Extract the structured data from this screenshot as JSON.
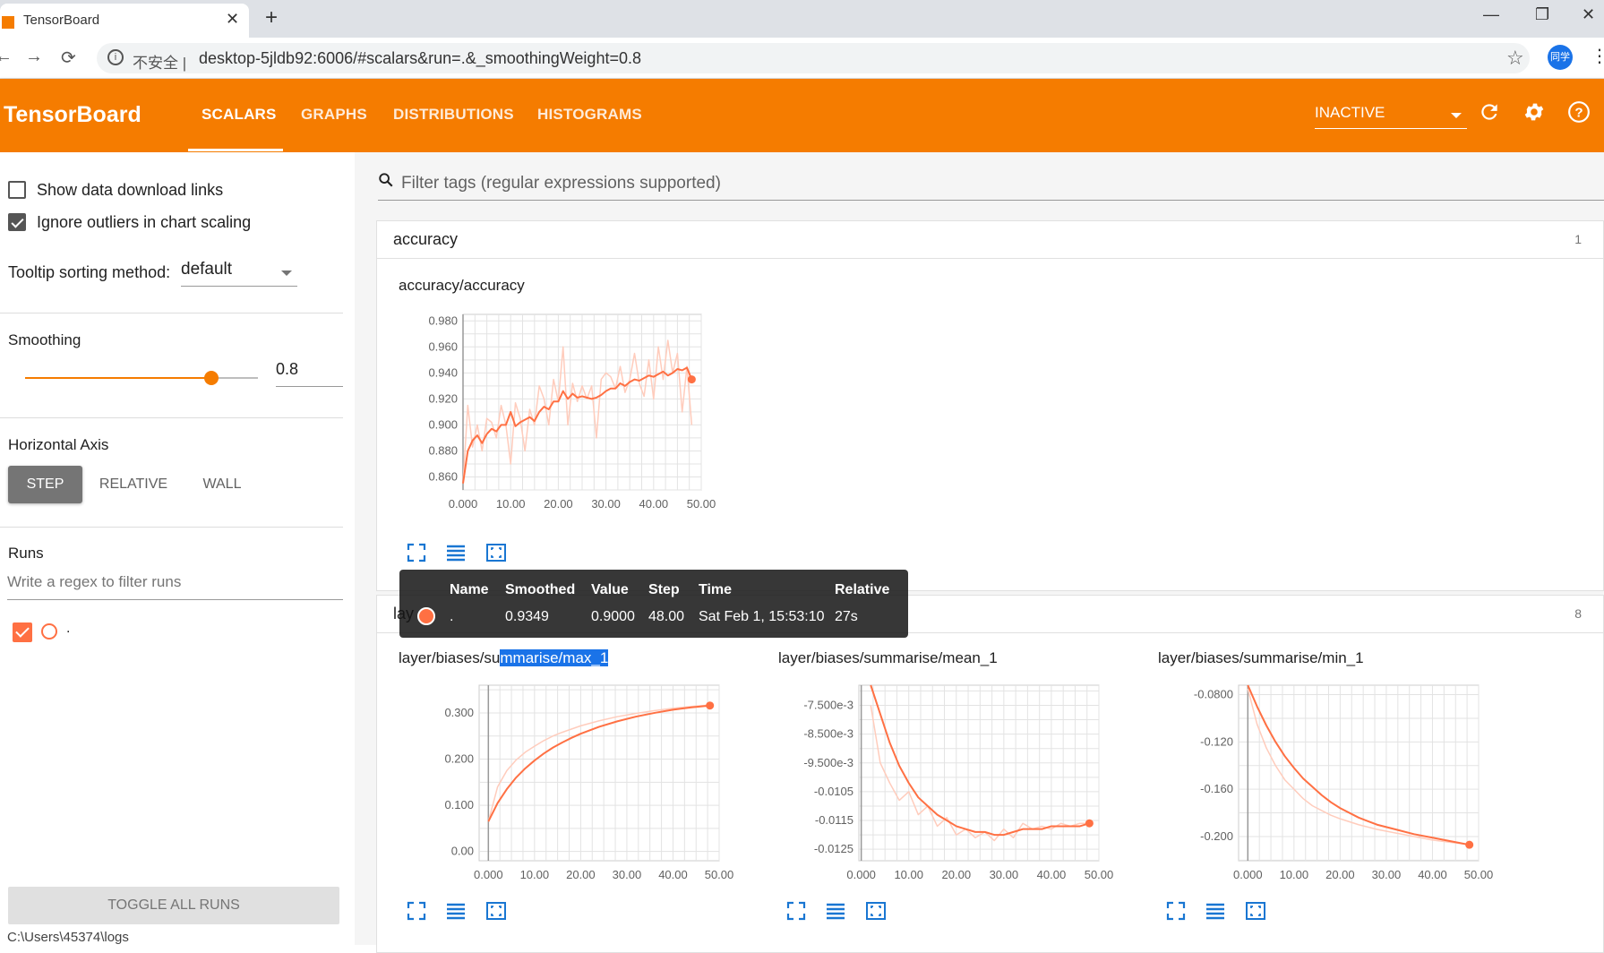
{
  "browser": {
    "tab_title": "TensorBoard",
    "tab_close": "✕",
    "new_tab": "+",
    "win_min": "—",
    "win_restore": "❐",
    "win_close": "✕",
    "back": "←",
    "forward": "→",
    "reload": "⟳",
    "insecure_label": "不安全 |",
    "url": "desktop-5jldb92:6006/#scalars&run=.&_smoothingWeight=0.8",
    "star": "☆",
    "profile": "同学",
    "menu": "⋮"
  },
  "header": {
    "brand": "TensorBoard",
    "tabs": [
      "SCALARS",
      "GRAPHS",
      "DISTRIBUTIONS",
      "HISTOGRAMS"
    ],
    "active_tab": "SCALARS",
    "status": "INACTIVE",
    "accent": "#f57c00"
  },
  "sidebar": {
    "show_download": "Show data download links",
    "show_download_checked": false,
    "ignore_outliers": "Ignore outliers in chart scaling",
    "ignore_outliers_checked": true,
    "tooltip_label": "Tooltip sorting method:",
    "tooltip_value": "default",
    "smoothing_label": "Smoothing",
    "smoothing_value": "0.8",
    "smoothing_fraction": 0.8,
    "haxis_label": "Horizontal Axis",
    "haxis_options": [
      "STEP",
      "RELATIVE",
      "WALL"
    ],
    "haxis_active": "STEP",
    "runs_label": "Runs",
    "runs_filter_placeholder": "Write a regex to filter runs",
    "run_name": ".",
    "run_color": "#ff7043",
    "toggle_all": "TOGGLE ALL RUNS",
    "logdir": "C:\\Users\\45374\\logs"
  },
  "main": {
    "filter_placeholder": "Filter tags (regular expressions supported)",
    "groups": [
      {
        "name": "accuracy",
        "count": "1"
      },
      {
        "name": "lay",
        "count": "8"
      }
    ],
    "charts": {
      "acc_title": "accuracy/accuracy",
      "max_title_pre": "layer/biases/su",
      "max_title_sel": "mmarise/max_1",
      "mean_title": "layer/biases/summarise/mean_1",
      "min_title": "layer/biases/summarise/min_1"
    }
  },
  "tooltip": {
    "headers": [
      "Name",
      "Smoothed",
      "Value",
      "Step",
      "Time",
      "Relative"
    ],
    "row": [
      ".",
      "0.9349",
      "0.9000",
      "48.00",
      "Sat Feb 1, 15:53:10",
      "27s"
    ]
  },
  "chart_data": [
    {
      "type": "line",
      "title": "accuracy/accuracy",
      "xlim": [
        0,
        50
      ],
      "ylim": [
        0.85,
        0.985
      ],
      "xticks": [
        "0.000",
        "10.00",
        "20.00",
        "30.00",
        "40.00",
        "50.00"
      ],
      "yticks": [
        "0.980",
        "0.960",
        "0.940",
        "0.920",
        "0.900",
        "0.880",
        "0.860"
      ],
      "ytick_values": [
        0.98,
        0.96,
        0.94,
        0.92,
        0.9,
        0.88,
        0.86
      ],
      "series": [
        {
          "name": "smoothed",
          "x": [
            0,
            1,
            2,
            3,
            4,
            5,
            6,
            7,
            8,
            9,
            10,
            11,
            12,
            13,
            14,
            15,
            16,
            17,
            18,
            19,
            20,
            21,
            22,
            23,
            24,
            25,
            26,
            27,
            28,
            29,
            30,
            31,
            32,
            33,
            34,
            35,
            36,
            37,
            38,
            39,
            40,
            41,
            42,
            43,
            44,
            45,
            46,
            47,
            48
          ],
          "y": [
            0.855,
            0.88,
            0.888,
            0.892,
            0.886,
            0.893,
            0.897,
            0.895,
            0.9,
            0.9,
            0.91,
            0.899,
            0.902,
            0.904,
            0.906,
            0.903,
            0.91,
            0.914,
            0.912,
            0.918,
            0.918,
            0.926,
            0.92,
            0.924,
            0.921,
            0.922,
            0.921,
            0.92,
            0.921,
            0.923,
            0.926,
            0.928,
            0.928,
            0.932,
            0.93,
            0.933,
            0.935,
            0.934,
            0.936,
            0.938,
            0.937,
            0.939,
            0.941,
            0.938,
            0.94,
            0.943,
            0.942,
            0.944,
            0.935
          ]
        },
        {
          "name": "raw",
          "x": [
            0,
            1,
            2,
            3,
            4,
            5,
            6,
            7,
            8,
            9,
            10,
            11,
            12,
            13,
            14,
            15,
            16,
            17,
            18,
            19,
            20,
            21,
            22,
            23,
            24,
            25,
            26,
            27,
            28,
            29,
            30,
            31,
            32,
            33,
            34,
            35,
            36,
            37,
            38,
            39,
            40,
            41,
            42,
            43,
            44,
            45,
            46,
            47,
            48
          ],
          "y": [
            0.855,
            0.915,
            0.883,
            0.9,
            0.88,
            0.905,
            0.902,
            0.89,
            0.915,
            0.9,
            0.87,
            0.917,
            0.905,
            0.88,
            0.912,
            0.9,
            0.93,
            0.92,
            0.9,
            0.935,
            0.918,
            0.96,
            0.9,
            0.932,
            0.918,
            0.93,
            0.92,
            0.93,
            0.89,
            0.935,
            0.94,
            0.937,
            0.928,
            0.945,
            0.925,
            0.935,
            0.955,
            0.932,
            0.922,
            0.95,
            0.92,
            0.96,
            0.935,
            0.965,
            0.94,
            0.955,
            0.91,
            0.945,
            0.9
          ]
        }
      ]
    },
    {
      "type": "line",
      "title": "layer/biases/summarise/max_1",
      "xlim": [
        -2,
        50
      ],
      "ylim": [
        -0.02,
        0.36
      ],
      "xticks": [
        "0.000",
        "10.00",
        "20.00",
        "30.00",
        "40.00",
        "50.00"
      ],
      "yticks": [
        "0.300",
        "0.200",
        "0.100",
        "0.00"
      ],
      "ytick_values": [
        0.3,
        0.2,
        0.1,
        0.0
      ],
      "series": [
        {
          "name": "smoothed",
          "x": [
            0,
            2,
            4,
            6,
            8,
            10,
            12,
            14,
            16,
            18,
            20,
            24,
            28,
            32,
            36,
            40,
            44,
            48
          ],
          "y": [
            0.065,
            0.105,
            0.135,
            0.16,
            0.18,
            0.197,
            0.212,
            0.225,
            0.236,
            0.246,
            0.255,
            0.27,
            0.282,
            0.292,
            0.3,
            0.307,
            0.312,
            0.316
          ]
        },
        {
          "name": "raw",
          "x": [
            0,
            2,
            4,
            6,
            8,
            10,
            12,
            14,
            16,
            18,
            20,
            24,
            28,
            32,
            36,
            40,
            44,
            48
          ],
          "y": [
            0.065,
            0.14,
            0.175,
            0.198,
            0.215,
            0.228,
            0.24,
            0.25,
            0.258,
            0.265,
            0.272,
            0.283,
            0.292,
            0.299,
            0.305,
            0.31,
            0.314,
            0.317
          ]
        }
      ]
    },
    {
      "type": "line",
      "title": "layer/biases/summarise/mean_1",
      "xlim": [
        -0.5,
        50
      ],
      "ylim": [
        -0.0129,
        -0.0068
      ],
      "xticks": [
        "0.000",
        "10.00",
        "20.00",
        "30.00",
        "40.00",
        "50.00"
      ],
      "yticks": [
        "-7.500e-3",
        "-8.500e-3",
        "-9.500e-3",
        "-0.0105",
        "-0.0115",
        "-0.0125"
      ],
      "ytick_values": [
        -0.0075,
        -0.0085,
        -0.0095,
        -0.0105,
        -0.0115,
        -0.0125
      ],
      "series": [
        {
          "name": "smoothed",
          "x": [
            2,
            4,
            6,
            8,
            10,
            12,
            14,
            16,
            18,
            20,
            22,
            24,
            26,
            28,
            30,
            32,
            34,
            36,
            38,
            40,
            42,
            44,
            46,
            48
          ],
          "y": [
            -0.0068,
            -0.0078,
            -0.0088,
            -0.0096,
            -0.0102,
            -0.0107,
            -0.011,
            -0.0113,
            -0.0115,
            -0.0117,
            -0.0118,
            -0.0119,
            -0.0119,
            -0.012,
            -0.012,
            -0.0119,
            -0.0118,
            -0.0118,
            -0.0118,
            -0.0117,
            -0.0117,
            -0.0117,
            -0.0117,
            -0.0116
          ]
        },
        {
          "name": "raw",
          "x": [
            2,
            4,
            6,
            8,
            10,
            12,
            14,
            16,
            18,
            20,
            22,
            24,
            26,
            28,
            30,
            32,
            34,
            36,
            38,
            40,
            42,
            44,
            46,
            48
          ],
          "y": [
            -0.0075,
            -0.0095,
            -0.0102,
            -0.0108,
            -0.0105,
            -0.0113,
            -0.011,
            -0.0117,
            -0.0114,
            -0.012,
            -0.0118,
            -0.0121,
            -0.0119,
            -0.0122,
            -0.0118,
            -0.0121,
            -0.0116,
            -0.0118,
            -0.0117,
            -0.0118,
            -0.0116,
            -0.0117,
            -0.0116,
            -0.0116
          ]
        }
      ]
    },
    {
      "type": "line",
      "title": "layer/biases/summarise/min_1",
      "xlim": [
        -2,
        50
      ],
      "ylim": [
        -0.2205,
        -0.072
      ],
      "xticks": [
        "0.000",
        "10.00",
        "20.00",
        "30.00",
        "40.00",
        "50.00"
      ],
      "yticks": [
        "-0.0800",
        "-0.120",
        "-0.160",
        "-0.200"
      ],
      "ytick_values": [
        -0.08,
        -0.12,
        -0.16,
        -0.2
      ],
      "series": [
        {
          "name": "smoothed",
          "x": [
            0,
            2,
            4,
            6,
            8,
            10,
            12,
            14,
            16,
            18,
            20,
            24,
            28,
            32,
            36,
            40,
            44,
            48
          ],
          "y": [
            -0.072,
            -0.09,
            -0.106,
            -0.12,
            -0.132,
            -0.142,
            -0.151,
            -0.158,
            -0.165,
            -0.171,
            -0.176,
            -0.184,
            -0.19,
            -0.194,
            -0.198,
            -0.201,
            -0.204,
            -0.207
          ]
        },
        {
          "name": "raw",
          "x": [
            0,
            2,
            4,
            6,
            8,
            10,
            12,
            14,
            16,
            18,
            20,
            24,
            28,
            32,
            36,
            40,
            44,
            48
          ],
          "y": [
            -0.075,
            -0.105,
            -0.125,
            -0.14,
            -0.152,
            -0.16,
            -0.168,
            -0.174,
            -0.178,
            -0.182,
            -0.185,
            -0.19,
            -0.194,
            -0.197,
            -0.2,
            -0.203,
            -0.205,
            -0.207
          ]
        }
      ]
    }
  ]
}
